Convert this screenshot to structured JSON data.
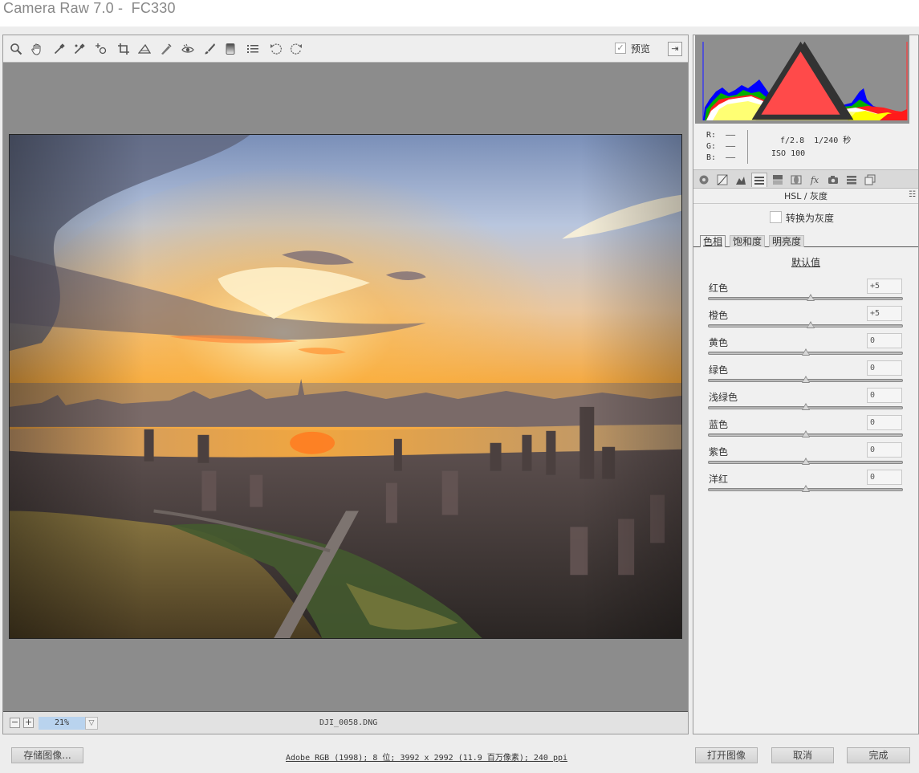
{
  "window": {
    "title": "Camera Raw 7.0 -  FC330"
  },
  "toolbar": {
    "tools": [
      {
        "name": "zoom-tool-icon",
        "glyph": "zoom"
      },
      {
        "name": "hand-tool-icon",
        "glyph": "hand"
      },
      {
        "name": "white-balance-tool-icon",
        "glyph": "eyedropper"
      },
      {
        "name": "color-sampler-tool-icon",
        "glyph": "sampler"
      },
      {
        "name": "targeted-adjustment-tool-icon",
        "glyph": "target"
      },
      {
        "name": "crop-tool-icon",
        "glyph": "crop"
      },
      {
        "name": "straighten-tool-icon",
        "glyph": "straighten"
      },
      {
        "name": "spot-removal-tool-icon",
        "glyph": "spot"
      },
      {
        "name": "red-eye-tool-icon",
        "glyph": "eye"
      },
      {
        "name": "adjustment-brush-icon",
        "glyph": "brush"
      },
      {
        "name": "graduated-filter-icon",
        "glyph": "filter"
      },
      {
        "name": "preferences-icon",
        "glyph": "list"
      },
      {
        "name": "rotate-ccw-icon",
        "glyph": "rotl"
      },
      {
        "name": "rotate-cw-icon",
        "glyph": "rotr"
      }
    ],
    "preview_label": "预览",
    "preview_checked": true,
    "fullscreen_glyph": "⇥"
  },
  "status": {
    "zoom_out": "−",
    "zoom_in": "+",
    "zoom_value": "21%",
    "filename": "DJI_0058.DNG"
  },
  "info": {
    "r_label": "R:  ——",
    "g_label": "G:  ——",
    "b_label": "B:  ——",
    "aperture_shutter": "f/2.8  1/240 秒",
    "iso": "ISO 100"
  },
  "panel": {
    "title": "HSL / 灰度",
    "menu_glyph": "☷",
    "convert_grayscale": "转换为灰度",
    "subtabs": [
      "色相",
      "饱和度",
      "明亮度"
    ],
    "active_subtab": 0,
    "default_link": "默认值",
    "sliders": [
      {
        "label": "红色",
        "value": "+5",
        "level": 5
      },
      {
        "label": "橙色",
        "value": "+5",
        "level": 5
      },
      {
        "label": "黄色",
        "value": "0",
        "level": 0
      },
      {
        "label": "绿色",
        "value": "0",
        "level": 0
      },
      {
        "label": "浅绿色",
        "value": "0",
        "level": 0
      },
      {
        "label": "蓝色",
        "value": "0",
        "level": 0
      },
      {
        "label": "紫色",
        "value": "0",
        "level": 0
      },
      {
        "label": "洋红",
        "value": "0",
        "level": 0
      }
    ]
  },
  "footer": {
    "save_label": "存储图像...",
    "workflow": "Adobe RGB (1998); 8 位; 3992 x 2992 (11.9 百万像素); 240 ppi",
    "open_label": "打开图像",
    "cancel_label": "取消",
    "done_label": "完成"
  }
}
